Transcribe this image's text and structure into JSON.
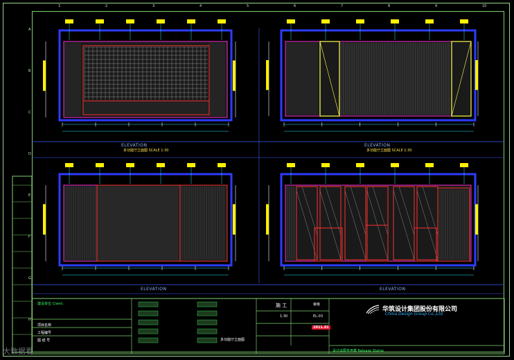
{
  "drawing": {
    "column_numbers": [
      "1",
      "2",
      "3",
      "4",
      "5",
      "6",
      "7",
      "8",
      "9",
      "10"
    ],
    "row_numbers": [
      "A",
      "B",
      "C",
      "D",
      "E",
      "F",
      "G",
      "H"
    ],
    "elevations": [
      {
        "label": "ELEVATION",
        "subtitle": "多功能厅立面图  SCALE 1:30"
      },
      {
        "label": "ELEVATION",
        "subtitle": "多功能厅立面图  SCALE 1:30"
      },
      {
        "label": "ELEVATION",
        "subtitle": ""
      },
      {
        "label": "ELEVATION",
        "subtitle": ""
      }
    ]
  },
  "title_block": {
    "client_label": "建设单位 Client:",
    "project_name": "多功能厅立面图",
    "stage_label": "施 工",
    "scale": "1:30",
    "sheet_code": "EL-03",
    "status": "审核",
    "date": "2011.01",
    "drawn_label": "设计出图专用章 Release Stamp",
    "company_cn": "华筑设计集团股份有限公司",
    "company_en": "China Design Group Co.,Ltd",
    "rows": [
      "项目名称",
      "工程编号",
      "图 纸 号"
    ]
  },
  "watermark": "大数据看",
  "colors": {
    "frame": "#7fd06f",
    "magenta": "#ff2bd6",
    "blue": "#2d3cff",
    "yellow": "#fff200",
    "cyan": "#21e5ff",
    "red": "#ff3030"
  }
}
